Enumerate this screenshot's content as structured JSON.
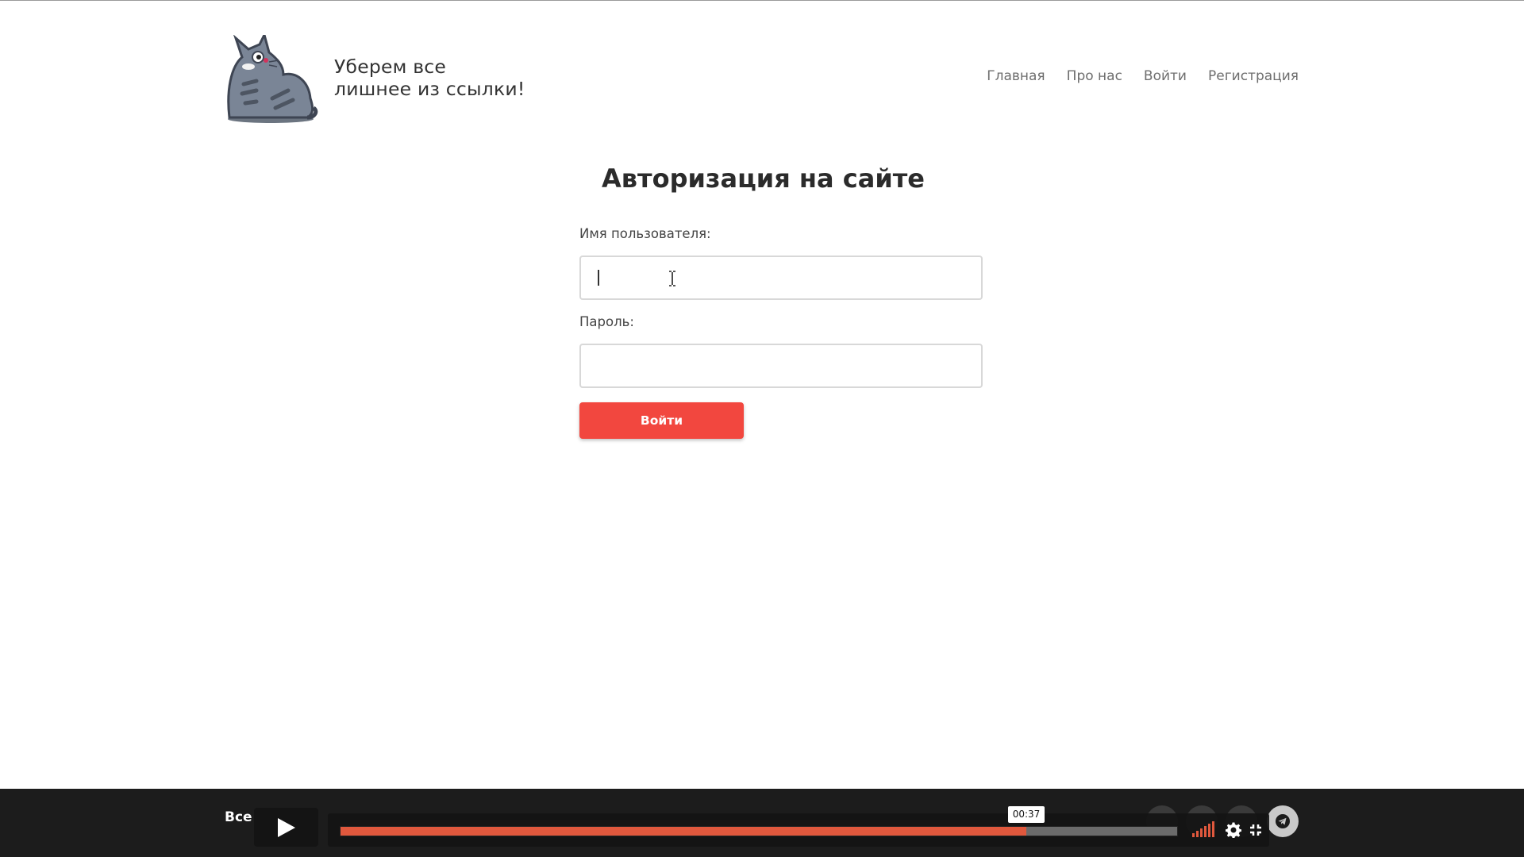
{
  "header": {
    "tagline_line1": "Уберем все",
    "tagline_line2": "лишнее из ссылки!",
    "nav": [
      "Главная",
      "Про нас",
      "Войти",
      "Регистрация"
    ]
  },
  "form": {
    "title": "Авторизация на сайте",
    "username_label": "Имя пользователя:",
    "username_value": "",
    "password_label": "Пароль:",
    "password_value": "",
    "submit_label": "Войти"
  },
  "footer": {
    "text": "Все"
  },
  "player": {
    "state": "paused",
    "current_time": "00:37",
    "progress": 0.82
  },
  "colors": {
    "accent": "#f2473f",
    "progress": "#e0583d",
    "footer_bg": "#1c1c1c"
  },
  "icons": {
    "logo": "cat-mascot",
    "play": "play-icon",
    "volume": "volume-bars-icon",
    "settings": "gear-icon",
    "fullscreen": "fullscreen-exit-icon",
    "telegram": "telegram-icon"
  }
}
